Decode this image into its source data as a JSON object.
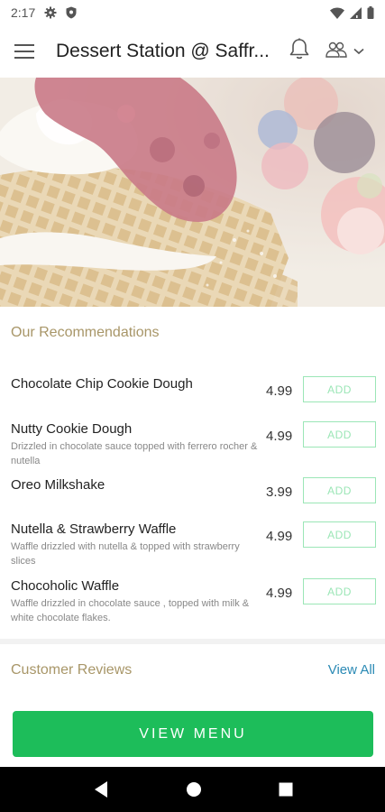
{
  "status_bar": {
    "time": "2:17"
  },
  "app_bar": {
    "title": "Dessert Station @ Saffr..."
  },
  "recommendations": {
    "title": "Our Recommendations",
    "items": [
      {
        "name": "Chocolate Chip Cookie Dough",
        "description": "",
        "price": "4.99",
        "add_label": "ADD"
      },
      {
        "name": "Nutty Cookie Dough",
        "description": "Drizzled in chocolate sauce topped with ferrero rocher & nutella",
        "price": "4.99",
        "add_label": "ADD"
      },
      {
        "name": "Oreo Milkshake",
        "description": "",
        "price": "3.99",
        "add_label": "ADD"
      },
      {
        "name": "Nutella & Strawberry Waffle",
        "description": "Waffle drizzled with nutella & topped with strawberry slices",
        "price": "4.99",
        "add_label": "ADD"
      },
      {
        "name": "Chocoholic Waffle",
        "description": "Waffle drizzled in chocolate sauce , topped with milk & white chocolate flakes.",
        "price": "4.99",
        "add_label": "ADD"
      }
    ]
  },
  "reviews": {
    "title": "Customer Reviews",
    "view_all_label": "View All"
  },
  "footer": {
    "view_menu_label": "VIEW MENU"
  },
  "colors": {
    "accent_green": "#1dbd5a",
    "add_border": "#9be6b6",
    "section_title": "#a89668",
    "link_blue": "#2b8ab5"
  },
  "icons": [
    "menu-icon",
    "bell-icon",
    "user-switch-icon",
    "chevron-down-icon",
    "gear-icon",
    "shield-icon",
    "wifi-icon",
    "signal-icon",
    "battery-icon",
    "back-icon",
    "home-icon",
    "recents-icon"
  ]
}
